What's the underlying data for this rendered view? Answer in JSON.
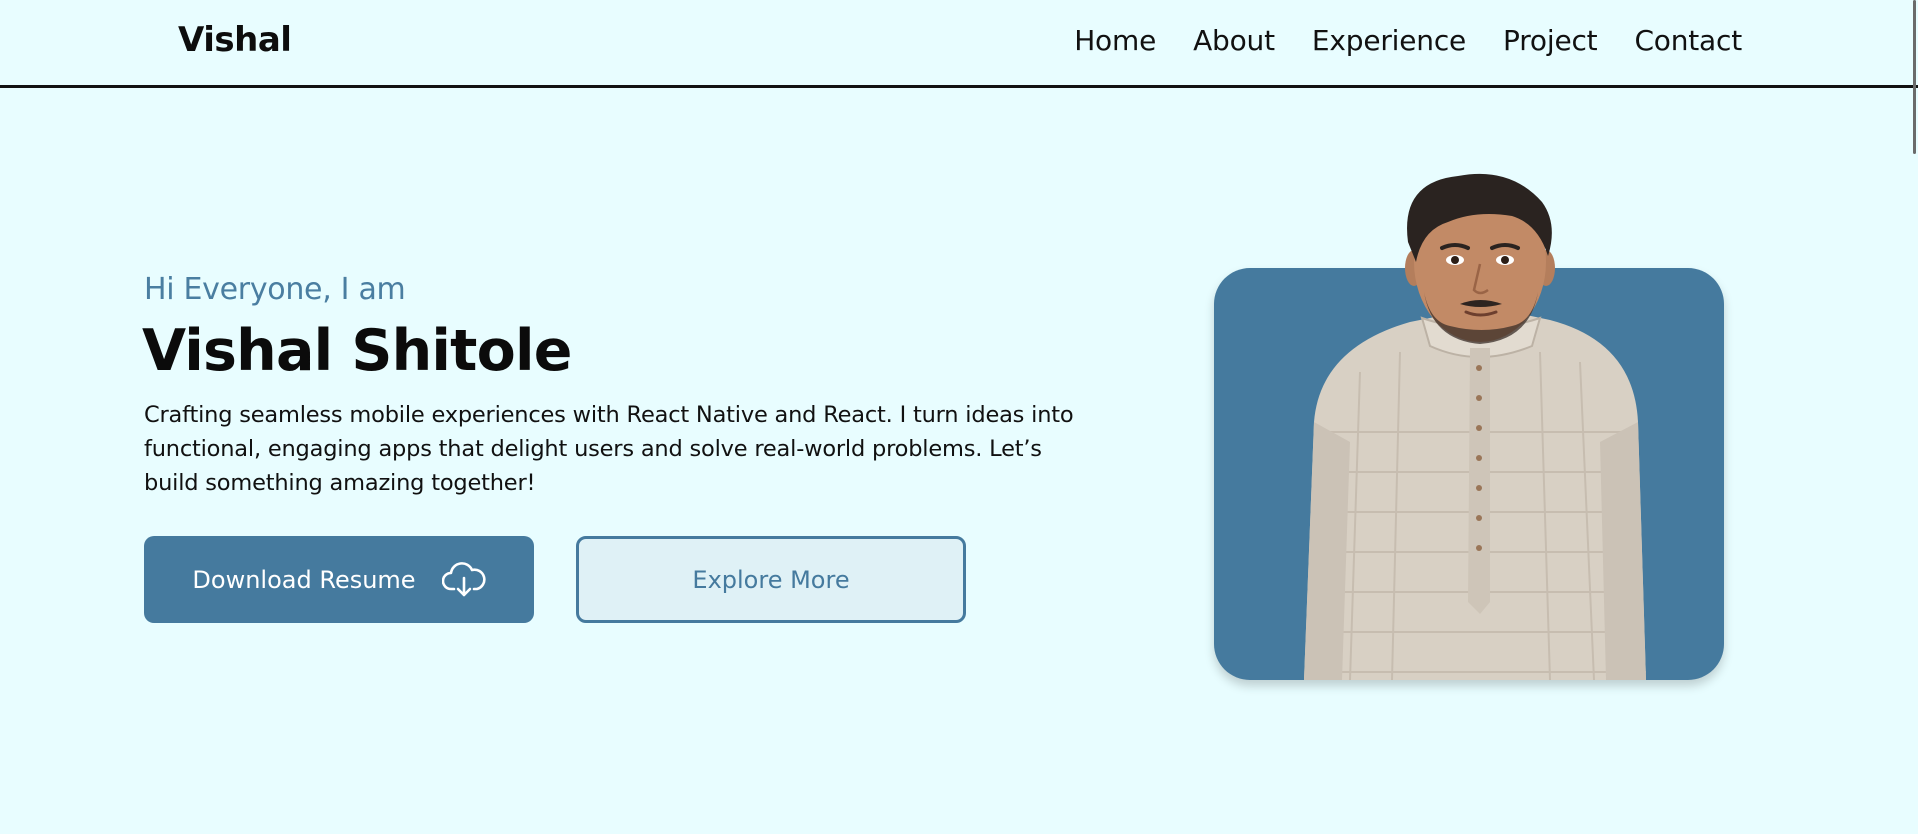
{
  "header": {
    "logo": "Vishal",
    "nav": [
      "Home",
      "About",
      "Experience",
      "Project",
      "Contact"
    ]
  },
  "hero": {
    "greeting": "Hi Everyone, I am",
    "name": "Vishal Shitole",
    "tagline": "Crafting seamless mobile experiences with React Native and React. I turn ideas into functional, engaging apps that delight users and solve real-world problems. Let’s build something amazing together!",
    "primary_button": {
      "label": "Download Resume",
      "icon": "cloud-download-icon"
    },
    "secondary_button": {
      "label": "Explore More"
    }
  },
  "colors": {
    "background": "#e8fdff",
    "accent": "#457a9e",
    "secondary_button_bg": "#dff1f6",
    "text": "#111111"
  }
}
